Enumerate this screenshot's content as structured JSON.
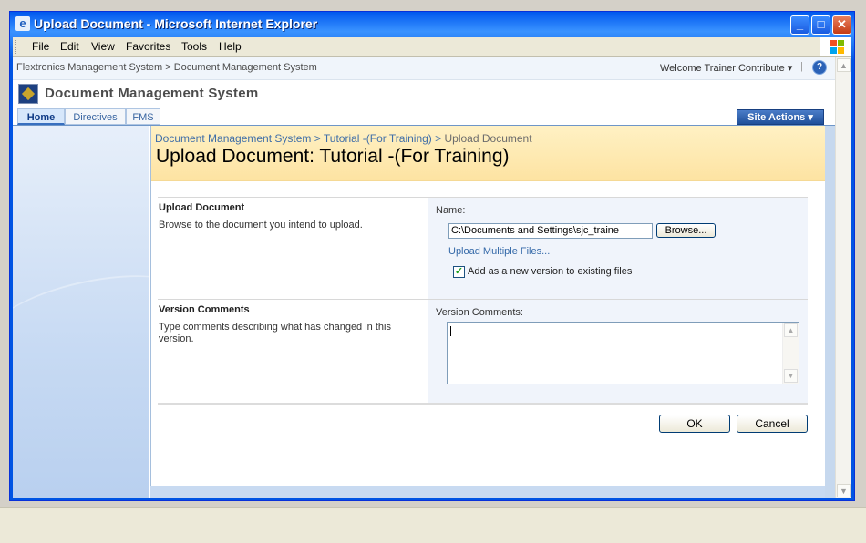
{
  "window": {
    "title": "Upload Document - Microsoft Internet Explorer",
    "ie_icon": "e"
  },
  "menu": [
    "File",
    "Edit",
    "View",
    "Favorites",
    "Tools",
    "Help"
  ],
  "topnav": {
    "breadcrumb": "Flextronics Management System > Document Management System",
    "welcome": "Welcome Trainer Contribute ▾",
    "separator": "|",
    "help": "?"
  },
  "site": {
    "title": "Document Management System",
    "tabs": [
      "Home",
      "Directives",
      "FMS"
    ],
    "selected_tab": "Home",
    "site_actions": "Site Actions ▾"
  },
  "page": {
    "breadcrumb": {
      "link1": "Document Management System",
      "sep1": " > ",
      "link2": "Tutorial -(For Training)",
      "sep2": " > ",
      "current": "Upload Document"
    },
    "title": "Upload Document: Tutorial -(For Training)"
  },
  "upload_section": {
    "heading": "Upload Document",
    "description": "Browse to the document you intend to upload.",
    "name_label": "Name:",
    "file_value": "C:\\Documents and Settings\\sjc_traine",
    "browse_label": "Browse...",
    "multiple_link": "Upload Multiple Files...",
    "checkbox_checked": true,
    "checkbox_mark": "✓",
    "checkbox_label": "Add as a new version to existing files"
  },
  "version_section": {
    "heading": "Version Comments",
    "description": "Type comments describing what has changed in this version.",
    "field_label": "Version Comments:",
    "value": ""
  },
  "buttons": {
    "ok": "OK",
    "cancel": "Cancel"
  },
  "colors": {
    "header_band": "#fde3a2",
    "link": "#3368a8",
    "site_actions": "#1f4f9a"
  }
}
